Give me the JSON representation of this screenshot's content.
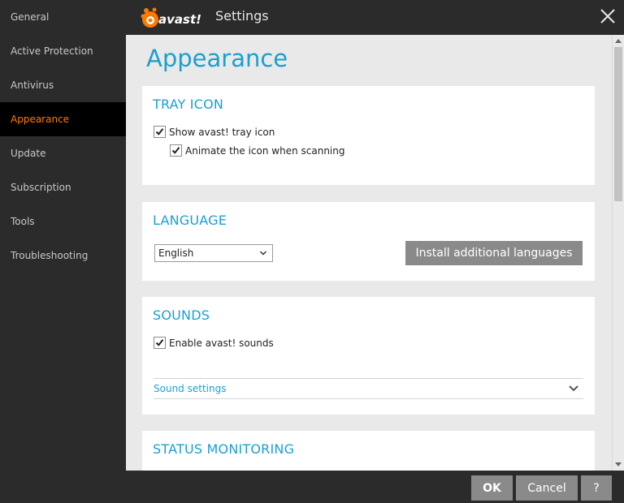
{
  "sidebar": {
    "items": [
      {
        "label": "General"
      },
      {
        "label": "Active Protection"
      },
      {
        "label": "Antivirus"
      },
      {
        "label": "Appearance",
        "active": true
      },
      {
        "label": "Update"
      },
      {
        "label": "Subscription"
      },
      {
        "label": "Tools"
      },
      {
        "label": "Troubleshooting"
      }
    ]
  },
  "header": {
    "logo_text": "avast!",
    "title": "Settings",
    "close_icon": "close-icon"
  },
  "main": {
    "page_title": "Appearance",
    "tray_icon": {
      "title": "TRAY ICON",
      "show_tray_icon": {
        "label": "Show avast! tray icon",
        "checked": true
      },
      "animate_icon": {
        "label": "Animate the icon when scanning",
        "checked": true
      }
    },
    "language": {
      "title": "LANGUAGE",
      "selected": "English",
      "install_button": "Install additional languages"
    },
    "sounds": {
      "title": "SOUNDS",
      "enable_sounds": {
        "label": "Enable avast! sounds",
        "checked": true
      },
      "sound_settings": "Sound settings"
    },
    "status_monitoring": {
      "title": "STATUS MONITORING"
    }
  },
  "footer": {
    "ok": "OK",
    "cancel": "Cancel",
    "help": "?"
  },
  "colors": {
    "accent": "#1b9fd0",
    "active_nav": "#ff7800",
    "sidebar_bg": "#2b2b2b",
    "content_bg": "#e9e9e9",
    "button_bg": "#8a8a8a"
  }
}
